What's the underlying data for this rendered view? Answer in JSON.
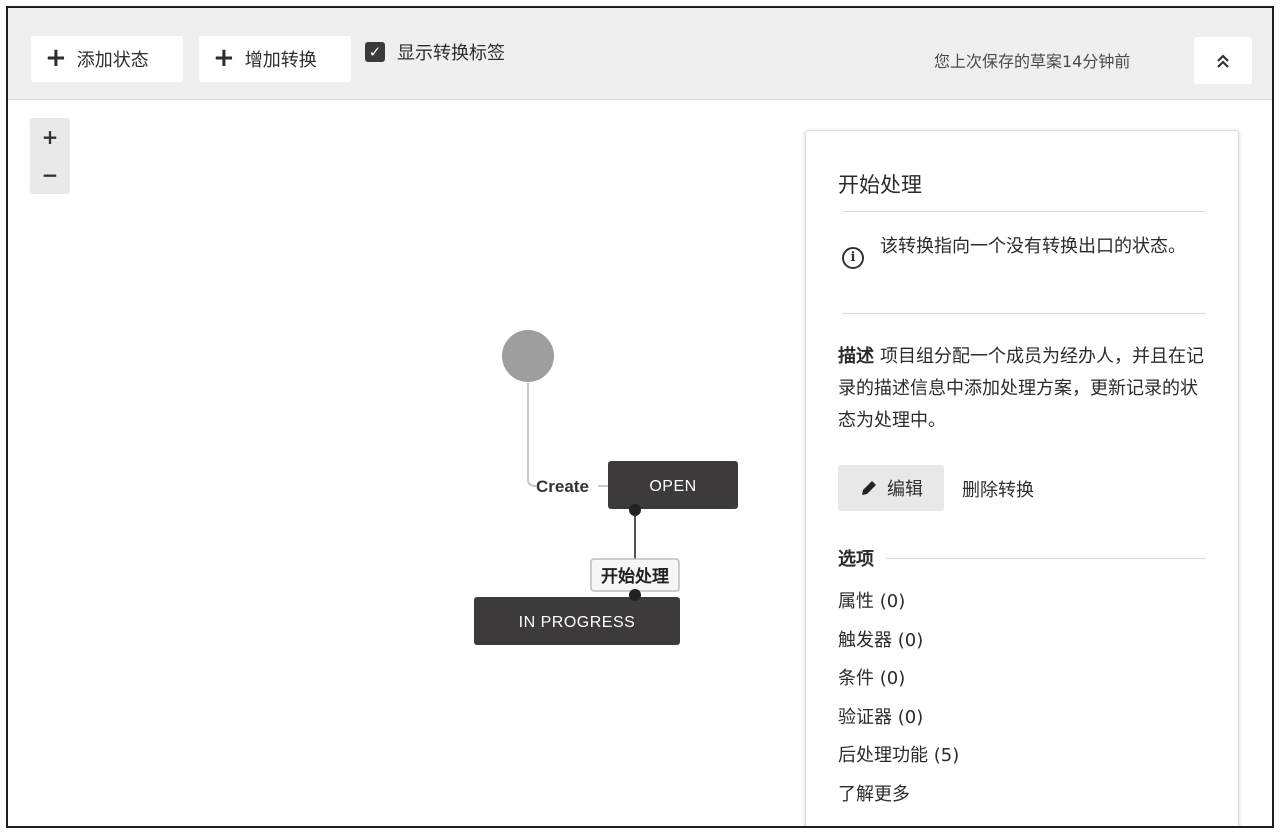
{
  "toolbar": {
    "add_state": "添加状态",
    "add_transition": "增加转换",
    "show_labels": "显示转换标签",
    "show_labels_checked": true,
    "saved_text": "您上次保存的草案14分钟前"
  },
  "zoom": {
    "in": "+",
    "out": "−"
  },
  "diagram": {
    "create_label": "Create",
    "open_state": "OPEN",
    "transition_label": "开始处理",
    "in_progress_state": "IN PROGRESS",
    "colors": {
      "state_fill": "#3c3a3a",
      "start_node": "#9e9e9e"
    }
  },
  "panel": {
    "title": "开始处理",
    "info": "该转换指向一个没有转换出口的状态。",
    "desc_label": "描述",
    "desc_text": "项目组分配一个成员为经办人，并且在记录的描述信息中添加处理方案，更新记录的状态为处理中。",
    "edit": "编辑",
    "delete": "删除转换",
    "options_title": "选项",
    "options": [
      "属性 (0)",
      "触发器 (0)",
      "条件 (0)",
      "验证器 (0)",
      "后处理功能 (5)",
      "了解更多"
    ]
  }
}
